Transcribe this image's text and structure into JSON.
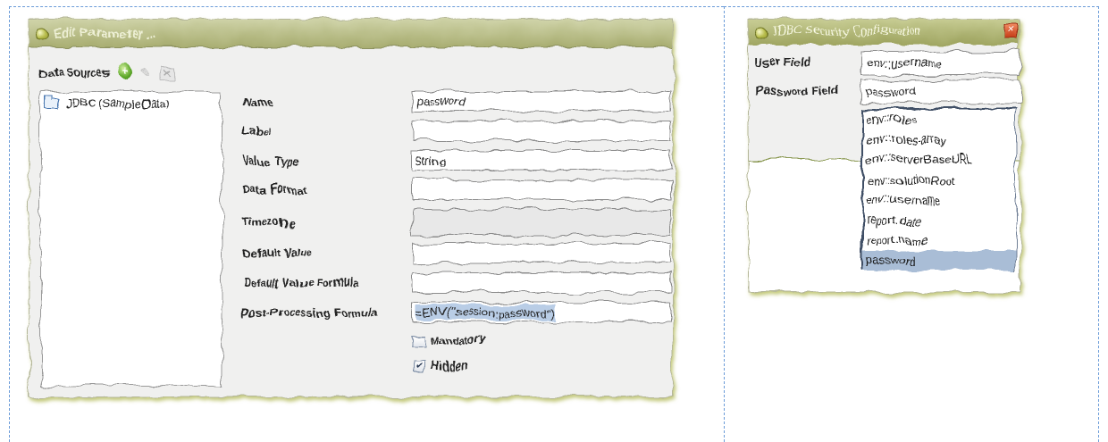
{
  "edit_dialog": {
    "title": "Edit Parameter ...",
    "datasources_label": "Data Sources",
    "tree_items": [
      "JDBC (SampleData)"
    ],
    "fields": [
      {
        "label": "Name",
        "value": "password"
      },
      {
        "label": "Label",
        "value": ""
      },
      {
        "label": "Value Type",
        "value": "String"
      },
      {
        "label": "Data Format",
        "value": ""
      },
      {
        "label": "Timezone",
        "value": ""
      },
      {
        "label": "Default Value",
        "value": ""
      },
      {
        "label": "Default Value Formula",
        "value": ""
      },
      {
        "label": "Post-Processing Formula",
        "value": "=ENV(\"session:password\")"
      }
    ],
    "checkboxes": [
      {
        "label": "Mandatory",
        "checked": false,
        "mark": ""
      },
      {
        "label": "Hidden",
        "checked": true,
        "mark": "✔"
      }
    ]
  },
  "jdbc_dialog": {
    "title": "JDBC Security Configuration",
    "close_glyph": "✕",
    "user_field_label": "User Field",
    "user_field_value": "env::username",
    "password_field_label": "Password Field",
    "password_field_value": "password",
    "dropdown_options": [
      "env::roles",
      "env::roles-array",
      "env::serverBaseURL",
      "env::solutionRoot",
      "env::username",
      "report.date",
      "report.name",
      "password"
    ],
    "selected_option": "password"
  },
  "colors": {
    "titlebar": "#a9ae72",
    "dashed_border": "#6a9bd8",
    "selection": "#a9bdd6"
  },
  "icons": [
    "dialog-ball-icon",
    "add-icon",
    "edit-pencil-icon",
    "delete-icon",
    "folder-icon",
    "close-icon",
    "checkbox-check-icon"
  ]
}
